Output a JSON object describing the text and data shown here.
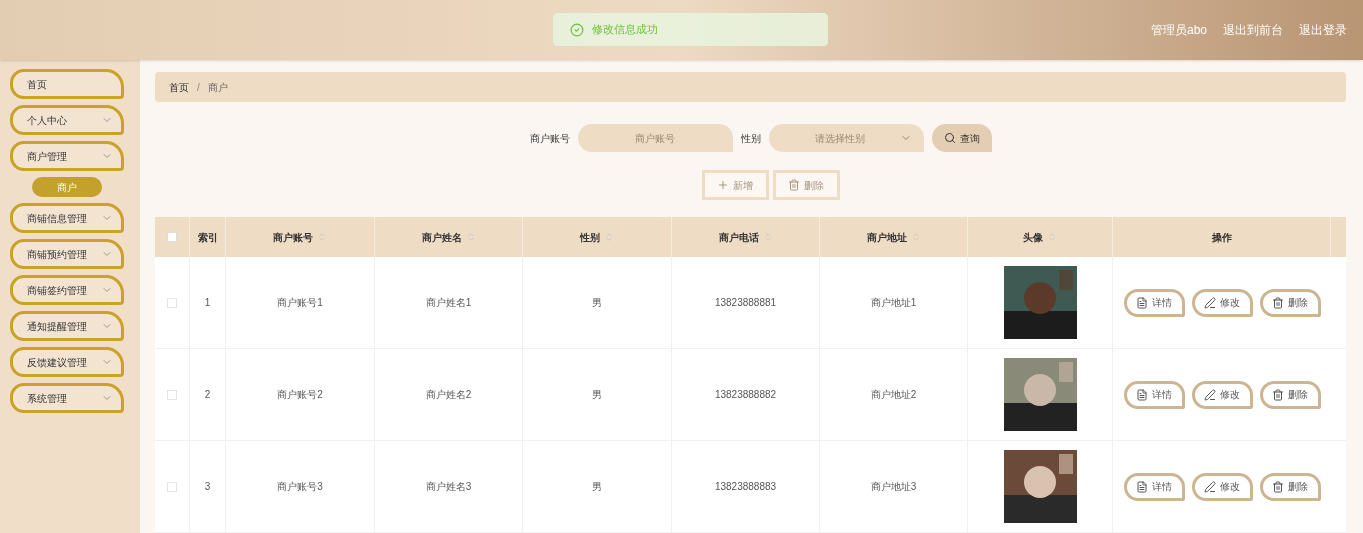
{
  "header": {
    "toast": "修改信息成功",
    "links": [
      "管理员abo",
      "退出到前台",
      "退出登录"
    ]
  },
  "sidebar": {
    "items": [
      {
        "label": "首页",
        "expandable": false
      },
      {
        "label": "个人中心",
        "expandable": true
      },
      {
        "label": "商户管理",
        "expandable": true,
        "children": [
          {
            "label": "商户",
            "selected": true
          }
        ]
      },
      {
        "label": "商铺信息管理",
        "expandable": true
      },
      {
        "label": "商铺预约管理",
        "expandable": true
      },
      {
        "label": "商铺签约管理",
        "expandable": true
      },
      {
        "label": "通知提醒管理",
        "expandable": true
      },
      {
        "label": "反馈建议管理",
        "expandable": true
      },
      {
        "label": "系统管理",
        "expandable": true
      }
    ]
  },
  "breadcrumb": {
    "items": [
      "首页",
      "商户"
    ],
    "separator": "/"
  },
  "search": {
    "fields": [
      {
        "label": "商户账号",
        "placeholder": "商户账号",
        "kind": "input"
      },
      {
        "label": "性别",
        "placeholder": "请选择性别",
        "kind": "select"
      }
    ],
    "button": "查询"
  },
  "actions": [
    {
      "label": "新增",
      "kind": "add",
      "disabled": true
    },
    {
      "label": "删除",
      "kind": "delete",
      "disabled": true
    }
  ],
  "table": {
    "columns": [
      {
        "label": "索引",
        "sortable": false
      },
      {
        "label": "商户账号",
        "sortable": true
      },
      {
        "label": "商户姓名",
        "sortable": true
      },
      {
        "label": "性别",
        "sortable": true
      },
      {
        "label": "商户电话",
        "sortable": true
      },
      {
        "label": "商户地址",
        "sortable": true
      },
      {
        "label": "头像",
        "sortable": true
      },
      {
        "label": "操作",
        "sortable": false
      }
    ],
    "header_checked": false,
    "rows": [
      {
        "checked": false,
        "cells": [
          "1",
          "商户账号1",
          "商户姓名1",
          "男",
          "13823888881",
          "商户地址1"
        ],
        "buttons": [
          {
            "label": "详情",
            "kind": "detail"
          },
          {
            "label": "修改",
            "kind": "edit"
          },
          {
            "label": "删除",
            "kind": "delete"
          }
        ]
      },
      {
        "checked": false,
        "cells": [
          "2",
          "商户账号2",
          "商户姓名2",
          "男",
          "13823888882",
          "商户地址2"
        ],
        "buttons": [
          {
            "label": "详情",
            "kind": "detail"
          },
          {
            "label": "修改",
            "kind": "edit"
          },
          {
            "label": "删除",
            "kind": "delete"
          }
        ]
      },
      {
        "checked": false,
        "cells": [
          "3",
          "商户账号3",
          "商户姓名3",
          "男",
          "13823888883",
          "商户地址3"
        ],
        "buttons": [
          {
            "label": "详情",
            "kind": "detail"
          },
          {
            "label": "修改",
            "kind": "edit"
          },
          {
            "label": "删除",
            "kind": "delete"
          }
        ]
      }
    ]
  }
}
